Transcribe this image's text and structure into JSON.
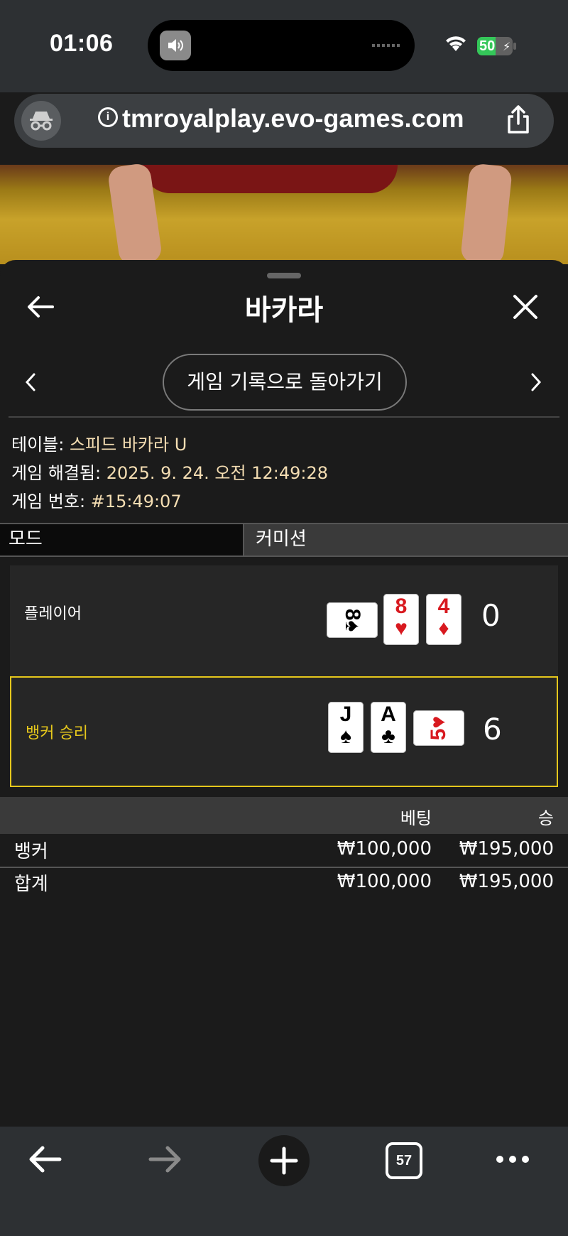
{
  "status_bar": {
    "time": "01:06",
    "battery": "50"
  },
  "browser": {
    "url": "tmroyalplay.evo-games.com",
    "tab_count": "57"
  },
  "sheet": {
    "title": "바카라",
    "history_button": "게임 기록으로 돌아가기",
    "info": {
      "table_label": "테이블:",
      "table_value": "스피드 바카라 U",
      "resolved_label": "게임 해결됨:",
      "resolved_value": "2025. 9. 24. 오전 12:49:28",
      "number_label": "게임 번호:",
      "number_value": "#15:49:07"
    },
    "tabs": {
      "mode": "모드",
      "commission": "커미션"
    },
    "player": {
      "label": "플레이어",
      "total": "0",
      "cards": [
        {
          "rank": "8",
          "suit": "♠",
          "color": "#000000",
          "orientation": "sideways"
        },
        {
          "rank": "8",
          "suit": "♥",
          "color": "#d8191f",
          "orientation": "upright"
        },
        {
          "rank": "4",
          "suit": "♦",
          "color": "#d8191f",
          "orientation": "upright"
        }
      ]
    },
    "banker": {
      "label": "뱅커 승리",
      "total": "6",
      "cards": [
        {
          "rank": "J",
          "suit": "♠",
          "color": "#000000",
          "orientation": "upright"
        },
        {
          "rank": "A",
          "suit": "♣",
          "color": "#000000",
          "orientation": "upright"
        },
        {
          "rank": "5",
          "suit": "♥",
          "color": "#d8191f",
          "orientation": "sideways"
        }
      ]
    },
    "results": {
      "headers": {
        "bet": "베팅",
        "win": "승"
      },
      "rows": [
        {
          "name": "뱅커",
          "bet": "₩100,000",
          "win": "₩195,000"
        },
        {
          "name": "합계",
          "bet": "₩100,000",
          "win": "₩195,000"
        }
      ]
    }
  },
  "colors": {
    "accent": "#e5c71c",
    "background": "#1b1b1b",
    "bar": "#2d3033"
  }
}
